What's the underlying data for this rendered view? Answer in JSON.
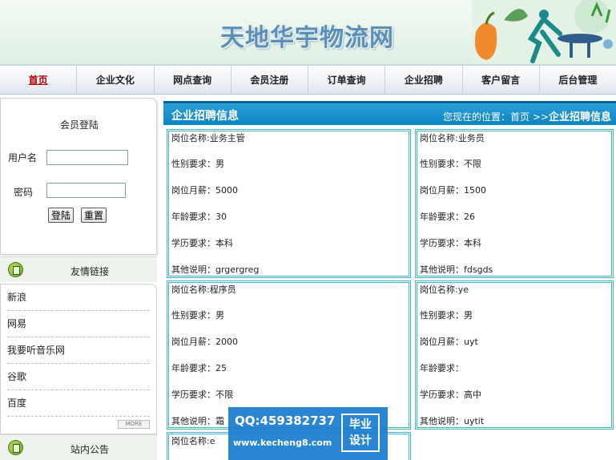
{
  "site": {
    "title": "天地华宇物流网"
  },
  "nav": [
    {
      "label": "首页",
      "active": true
    },
    {
      "label": "企业文化"
    },
    {
      "label": "网点查询"
    },
    {
      "label": "会员注册"
    },
    {
      "label": "订单查询"
    },
    {
      "label": "企业招聘"
    },
    {
      "label": "客户留言"
    },
    {
      "label": "后台管理"
    }
  ],
  "login": {
    "title": "会员登陆",
    "username_label": "用户名",
    "password_label": "密码",
    "username_value": "",
    "password_value": "",
    "login_button": "登陆",
    "reset_button": "重置"
  },
  "friend_links": {
    "title": "友情链接",
    "items": [
      "新浪",
      "网易",
      "我要听音乐网",
      "谷歌",
      "百度"
    ],
    "more_label": "MORE"
  },
  "notice": {
    "title": "站内公告"
  },
  "main": {
    "title": "企业招聘信息",
    "location_prefix": "您现在的位置：首页",
    "location_sep": ">>",
    "location_current": "企业招聘信息"
  },
  "jobs": [
    {
      "lines": [
        "岗位名称:业务主管",
        "性别要求：男",
        "岗位月薪：5000",
        "年龄要求：30",
        "学历要求：本科",
        "其他说明：grgergreg"
      ]
    },
    {
      "lines": [
        "岗位名称:业务员",
        "性别要求：不限",
        "岗位月薪：1500",
        "年龄要求：26",
        "学历要求：本科",
        "其他说明：fdsgds"
      ]
    },
    {
      "lines": [
        "岗位名称:程序员",
        "性别要求：男",
        "岗位月薪：2000",
        "年龄要求：25",
        "学历要求：不限",
        "其他说明：霜"
      ]
    },
    {
      "lines": [
        "岗位名称:ye",
        "性别要求：男",
        "岗位月薪：uyt",
        "年龄要求：",
        "学历要求：高中",
        "其他说明：uytit"
      ]
    },
    {
      "lines": [
        "岗位名称:e"
      ]
    }
  ],
  "watermark": {
    "qq": "QQ:459382737",
    "url": "www.kecheng8.com",
    "badge_line1": "毕业",
    "badge_line2": "设计"
  }
}
